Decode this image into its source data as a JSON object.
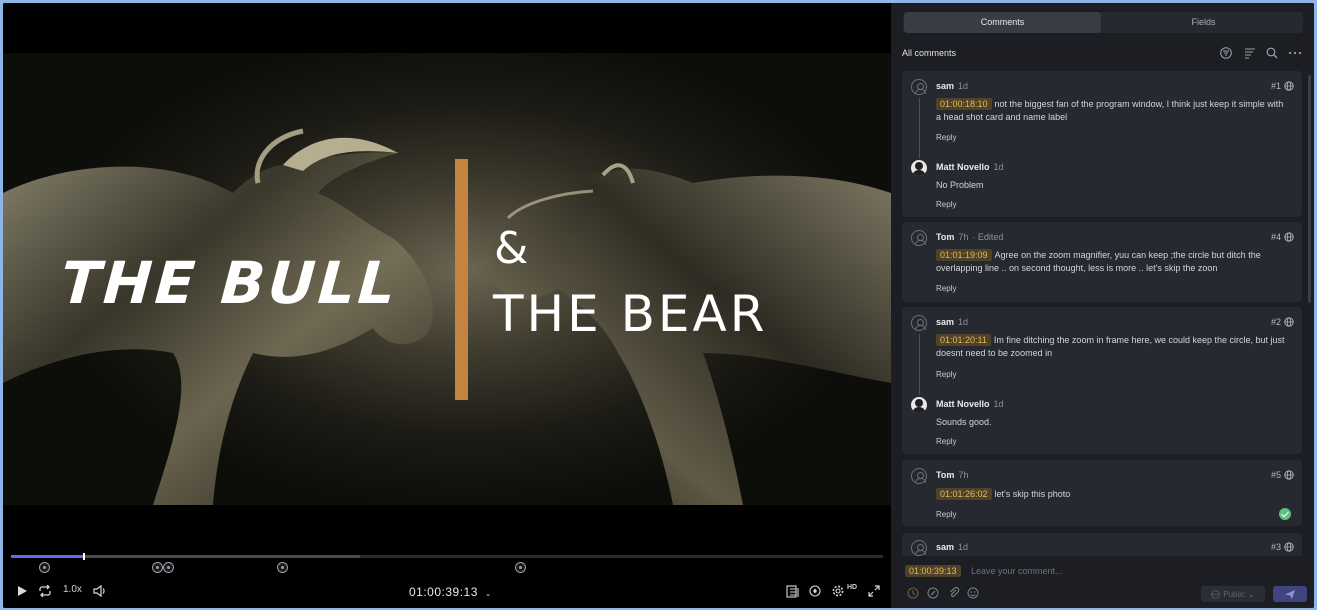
{
  "video": {
    "title_left": "THE BULL",
    "title_amp": "&",
    "title_right": "THE BEAR"
  },
  "player": {
    "progress": 0.083,
    "speed_label": "1.0x",
    "timecode": "01:00:39:13",
    "quality_label": "HD"
  },
  "panel": {
    "tabs": [
      {
        "label": "Comments",
        "active": true
      },
      {
        "label": "Fields",
        "active": false
      }
    ],
    "list_label": "All comments",
    "comments": [
      {
        "author": "sam",
        "age": "1d",
        "number": "#1",
        "timecode": "01:00:18:10",
        "text": "not the biggest fan of the program window, I think just keep it simple with a head shot card and name label",
        "reply_label": "Reply",
        "reply": {
          "author": "Matt Novello",
          "age": "1d",
          "text": "No Problem",
          "reply_label": "Reply"
        }
      },
      {
        "author": "Tom",
        "age": "7h",
        "edited": "· Edited",
        "number": "#4",
        "timecode": "01:01:19:09",
        "text": "Agree on the zoom magnifier, yuu can keep ;the circle but ditch the overlapping line .. on second thought, less is more .. let's skip the zoon",
        "reply_label": "Reply"
      },
      {
        "author": "sam",
        "age": "1d",
        "number": "#2",
        "timecode": "01:01:20:11",
        "text": "Im fine ditching the zoom in frame here, we could keep the circle, but just doesnt need to be zoomed in",
        "reply_label": "Reply",
        "reply": {
          "author": "Matt Novello",
          "age": "1d",
          "text": "Sounds good.",
          "reply_label": "Reply"
        }
      },
      {
        "author": "Tom",
        "age": "7h",
        "number": "#5",
        "timecode": "01:01:26:02",
        "text": "let's skip this photo",
        "reply_label": "Reply",
        "resolved": true
      },
      {
        "author": "sam",
        "age": "1d",
        "number": "#3"
      }
    ],
    "composer": {
      "timecode": "01:00:39:13",
      "placeholder": "Leave your comment...",
      "visibility_label": "Public",
      "send_icon": "send-icon"
    }
  }
}
